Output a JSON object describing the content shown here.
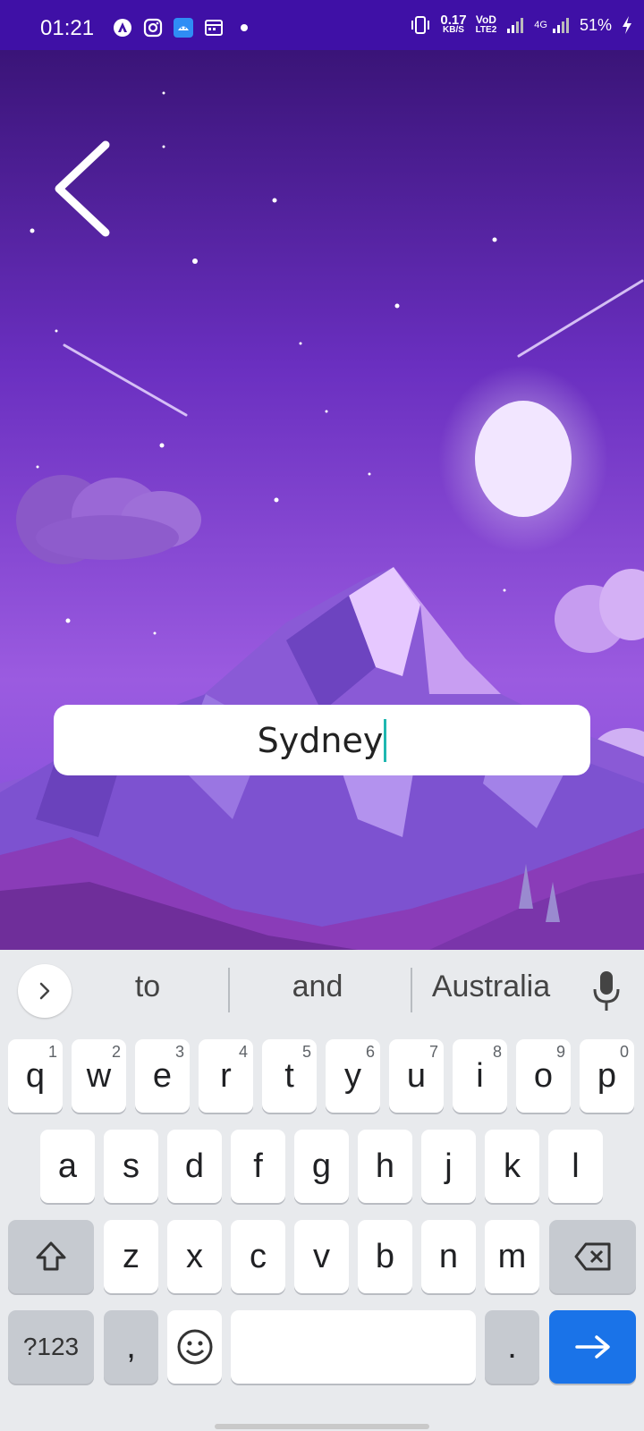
{
  "status_bar": {
    "time": "01:21",
    "left_icons": [
      "app-icon-a",
      "instagram-icon",
      "android-icon",
      "calendar-icon",
      "dot-icon"
    ],
    "net_speed_value": "0.17",
    "net_speed_unit": "KB/S",
    "volte_top": "VoD",
    "volte_bottom": "LTE2",
    "network_type": "4G",
    "battery": "51%"
  },
  "search": {
    "value": "Sydney"
  },
  "keyboard": {
    "suggestions": [
      "to",
      "and",
      "Australia"
    ],
    "row1": [
      {
        "key": "q",
        "hint": "1"
      },
      {
        "key": "w",
        "hint": "2"
      },
      {
        "key": "e",
        "hint": "3"
      },
      {
        "key": "r",
        "hint": "4"
      },
      {
        "key": "t",
        "hint": "5"
      },
      {
        "key": "y",
        "hint": "6"
      },
      {
        "key": "u",
        "hint": "7"
      },
      {
        "key": "i",
        "hint": "8"
      },
      {
        "key": "o",
        "hint": "9"
      },
      {
        "key": "p",
        "hint": "0"
      }
    ],
    "row2": [
      "a",
      "s",
      "d",
      "f",
      "g",
      "h",
      "j",
      "k",
      "l"
    ],
    "row3": [
      "z",
      "x",
      "c",
      "v",
      "b",
      "n",
      "m"
    ],
    "symbols_label": "?123",
    "comma_label": ",",
    "period_label": "."
  },
  "colors": {
    "status_bar": "#3f10a6",
    "enter_key": "#1a73e8",
    "caret": "#1fb7b0"
  }
}
